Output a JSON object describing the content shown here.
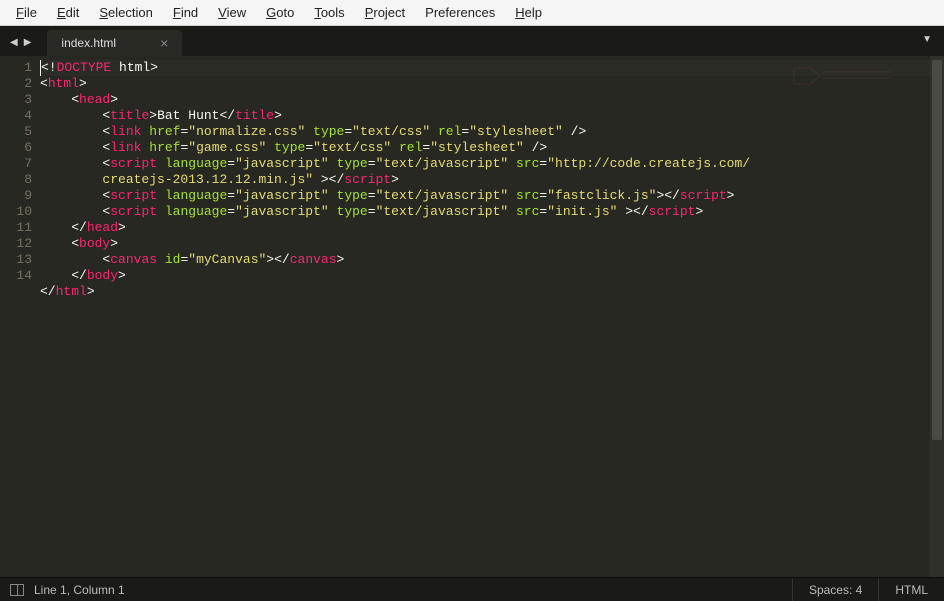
{
  "menubar": {
    "items": [
      "File",
      "Edit",
      "Selection",
      "Find",
      "View",
      "Goto",
      "Tools",
      "Project",
      "Preferences",
      "Help"
    ]
  },
  "tab": {
    "filename": "index.html",
    "close_glyph": "×"
  },
  "nav": {
    "back": "◀",
    "forward": "▶",
    "menu": "▼"
  },
  "code": {
    "lines": [
      {
        "num": "1"
      },
      {
        "num": "2"
      },
      {
        "num": "3"
      },
      {
        "num": "4"
      },
      {
        "num": "5"
      },
      {
        "num": "6"
      },
      {
        "num": "7"
      },
      {
        "num": "8"
      },
      {
        "num": "9"
      },
      {
        "num": "10"
      },
      {
        "num": "11"
      },
      {
        "num": "12"
      },
      {
        "num": "13"
      },
      {
        "num": "14"
      }
    ],
    "raw": {
      "doctype": {
        "open": "<!",
        "kw": "DOCTYPE",
        "text": " html",
        "close": ">"
      },
      "html_open": {
        "lt": "<",
        "tag": "html",
        "gt": ">"
      },
      "head_open": {
        "indent": "    ",
        "lt": "<",
        "tag": "head",
        "gt": ">"
      },
      "title": {
        "indent": "        ",
        "lt": "<",
        "tag_open": "title",
        "gt": ">",
        "text": "Bat Hunt",
        "lt2": "</",
        "tag_close": "title",
        "gt2": ">"
      },
      "link1": {
        "indent": "        ",
        "lt": "<",
        "tag": "link",
        "sp": " ",
        "a1": "href",
        "eq": "=",
        "v1": "\"normalize.css\"",
        "a2": "type",
        "v2": "\"text/css\"",
        "a3": "rel",
        "v3": "\"stylesheet\"",
        "end": " />"
      },
      "link2": {
        "indent": "        ",
        "lt": "<",
        "tag": "link",
        "sp": " ",
        "a1": "href",
        "eq": "=",
        "v1": "\"game.css\"",
        "a2": "type",
        "v2": "\"text/css\"",
        "a3": "rel",
        "v3": "\"stylesheet\"",
        "end": " />"
      },
      "script1a": {
        "indent": "        ",
        "lt": "<",
        "tag": "script",
        "sp": " ",
        "a1": "language",
        "eq": "=",
        "v1": "\"javascript\"",
        "a2": "type",
        "v2": "\"text/javascript\"",
        "a3": "src",
        "v3": "\"http://code.createjs.com/"
      },
      "script1b": {
        "indent": "        ",
        "v3b": "createjs-2013.12.12.min.js\"",
        "mid": " >",
        "lt2": "</",
        "tag2": "script",
        "gt2": ">"
      },
      "script2": {
        "indent": "        ",
        "lt": "<",
        "tag": "script",
        "sp": " ",
        "a1": "language",
        "eq": "=",
        "v1": "\"javascript\"",
        "a2": "type",
        "v2": "\"text/javascript\"",
        "a3": "src",
        "v3": "\"fastclick.js\"",
        "gt": ">",
        "lt2": "</",
        "tag2": "script",
        "gt2": ">"
      },
      "script3": {
        "indent": "        ",
        "lt": "<",
        "tag": "script",
        "sp": " ",
        "a1": "language",
        "eq": "=",
        "v1": "\"javascript\"",
        "a2": "type",
        "v2": "\"text/javascript\"",
        "a3": "src",
        "v3": "\"init.js\"",
        "mid": " >",
        "lt2": "</",
        "tag2": "script",
        "gt2": ">"
      },
      "head_close": {
        "indent": "    ",
        "lt": "</",
        "tag": "head",
        "gt": ">"
      },
      "body_open": {
        "indent": "    ",
        "lt": "<",
        "tag": "body",
        "gt": ">"
      },
      "canvas": {
        "indent": "        ",
        "lt": "<",
        "tag": "canvas",
        "sp": " ",
        "a1": "id",
        "eq": "=",
        "v1": "\"myCanvas\"",
        "gt": ">",
        "lt2": "</",
        "tag2": "canvas",
        "gt2": ">"
      },
      "body_close": {
        "indent": "    ",
        "lt": "</",
        "tag": "body",
        "gt": ">"
      },
      "html_close": {
        "lt": "</",
        "tag": "html",
        "gt": ">"
      }
    }
  },
  "status": {
    "position": "Line 1, Column 1",
    "spaces": "Spaces: 4",
    "syntax": "HTML"
  }
}
